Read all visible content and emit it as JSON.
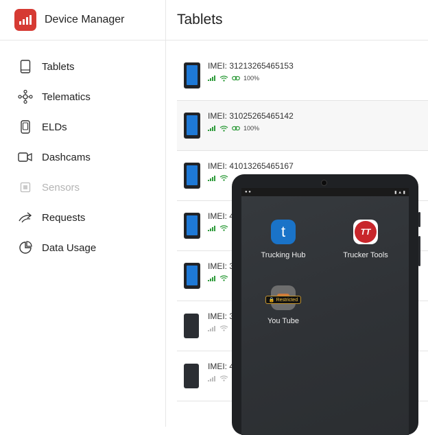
{
  "app": {
    "title": "Device Manager"
  },
  "sidebar": {
    "items": [
      {
        "label": "Tablets",
        "icon": "tablet-icon",
        "disabled": false
      },
      {
        "label": "Telematics",
        "icon": "telematics-icon",
        "disabled": false
      },
      {
        "label": "ELDs",
        "icon": "eld-icon",
        "disabled": false
      },
      {
        "label": "Dashcams",
        "icon": "dashcam-icon",
        "disabled": false
      },
      {
        "label": "Sensors",
        "icon": "sensor-icon",
        "disabled": true
      },
      {
        "label": "Requests",
        "icon": "requests-icon",
        "disabled": false
      },
      {
        "label": "Data Usage",
        "icon": "data-usage-icon",
        "disabled": false
      }
    ]
  },
  "main": {
    "title": "Tablets",
    "rows": [
      {
        "imei": "IMEI: 31213265465153",
        "battery": "100%"
      },
      {
        "imei": "IMEI: 31025265465142",
        "battery": "100%"
      },
      {
        "imei": "IMEI: 41013265465167"
      },
      {
        "imei": "IMEI: 4"
      },
      {
        "imei": "IMEI: 3"
      },
      {
        "imei": "IMEI: 3"
      },
      {
        "imei": "IMEI: 4"
      }
    ]
  },
  "tablet_preview": {
    "apps": [
      {
        "label": "Trucking Hub",
        "icon": "trucking-hub-icon",
        "glyph": "t",
        "color": "#1a73c8"
      },
      {
        "label": "Trucker Tools",
        "icon": "trucker-tools-icon",
        "glyph": "TT",
        "color": "#c8262b"
      },
      {
        "label": "You Tube",
        "icon": "youtube-icon",
        "badge": "Restricted"
      }
    ]
  },
  "colors": {
    "brand": "#d63a33",
    "signal_active": "#2e9b3a",
    "signal_inactive": "#bbbbbb"
  }
}
